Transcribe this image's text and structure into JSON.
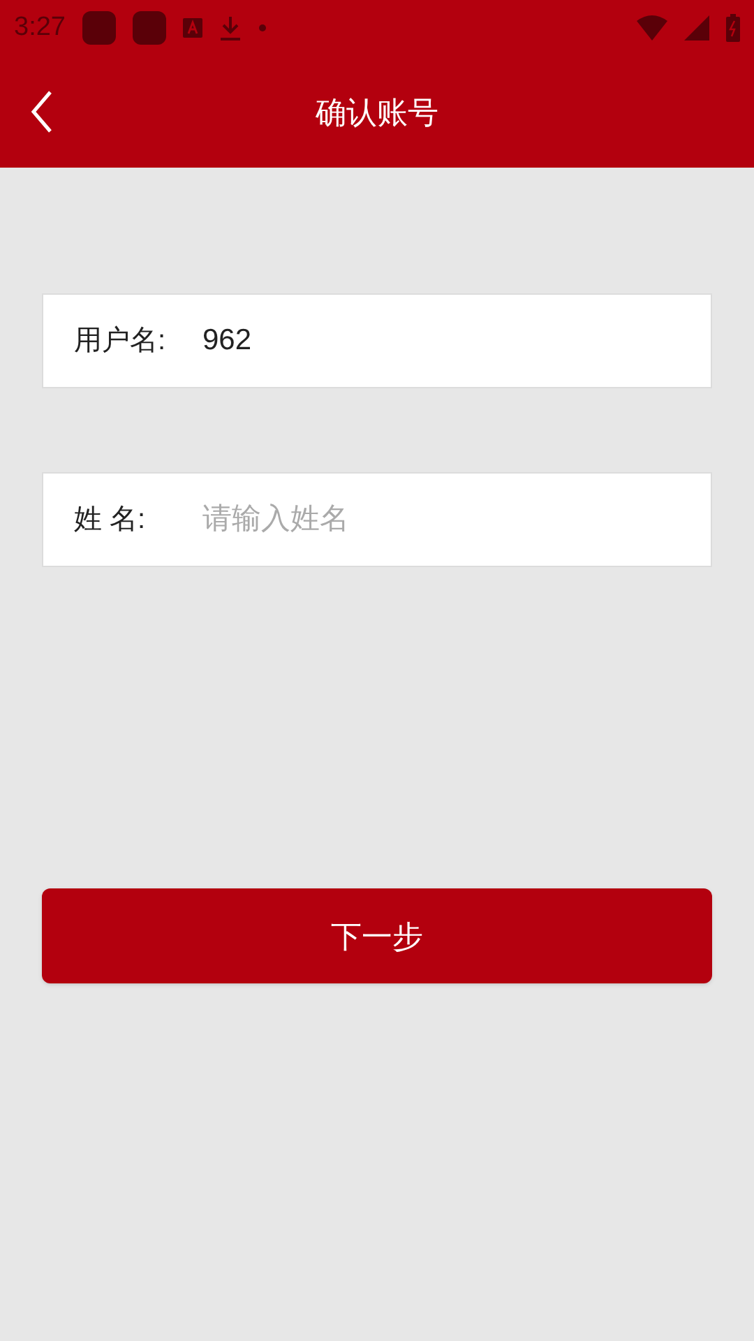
{
  "status_bar": {
    "time": "3:27"
  },
  "header": {
    "title": "确认账号"
  },
  "fields": [
    {
      "label": "用户名:",
      "value": "962"
    },
    {
      "label": "姓 名:",
      "placeholder": "请输入姓名"
    }
  ],
  "next_button": {
    "label": "下一步"
  }
}
